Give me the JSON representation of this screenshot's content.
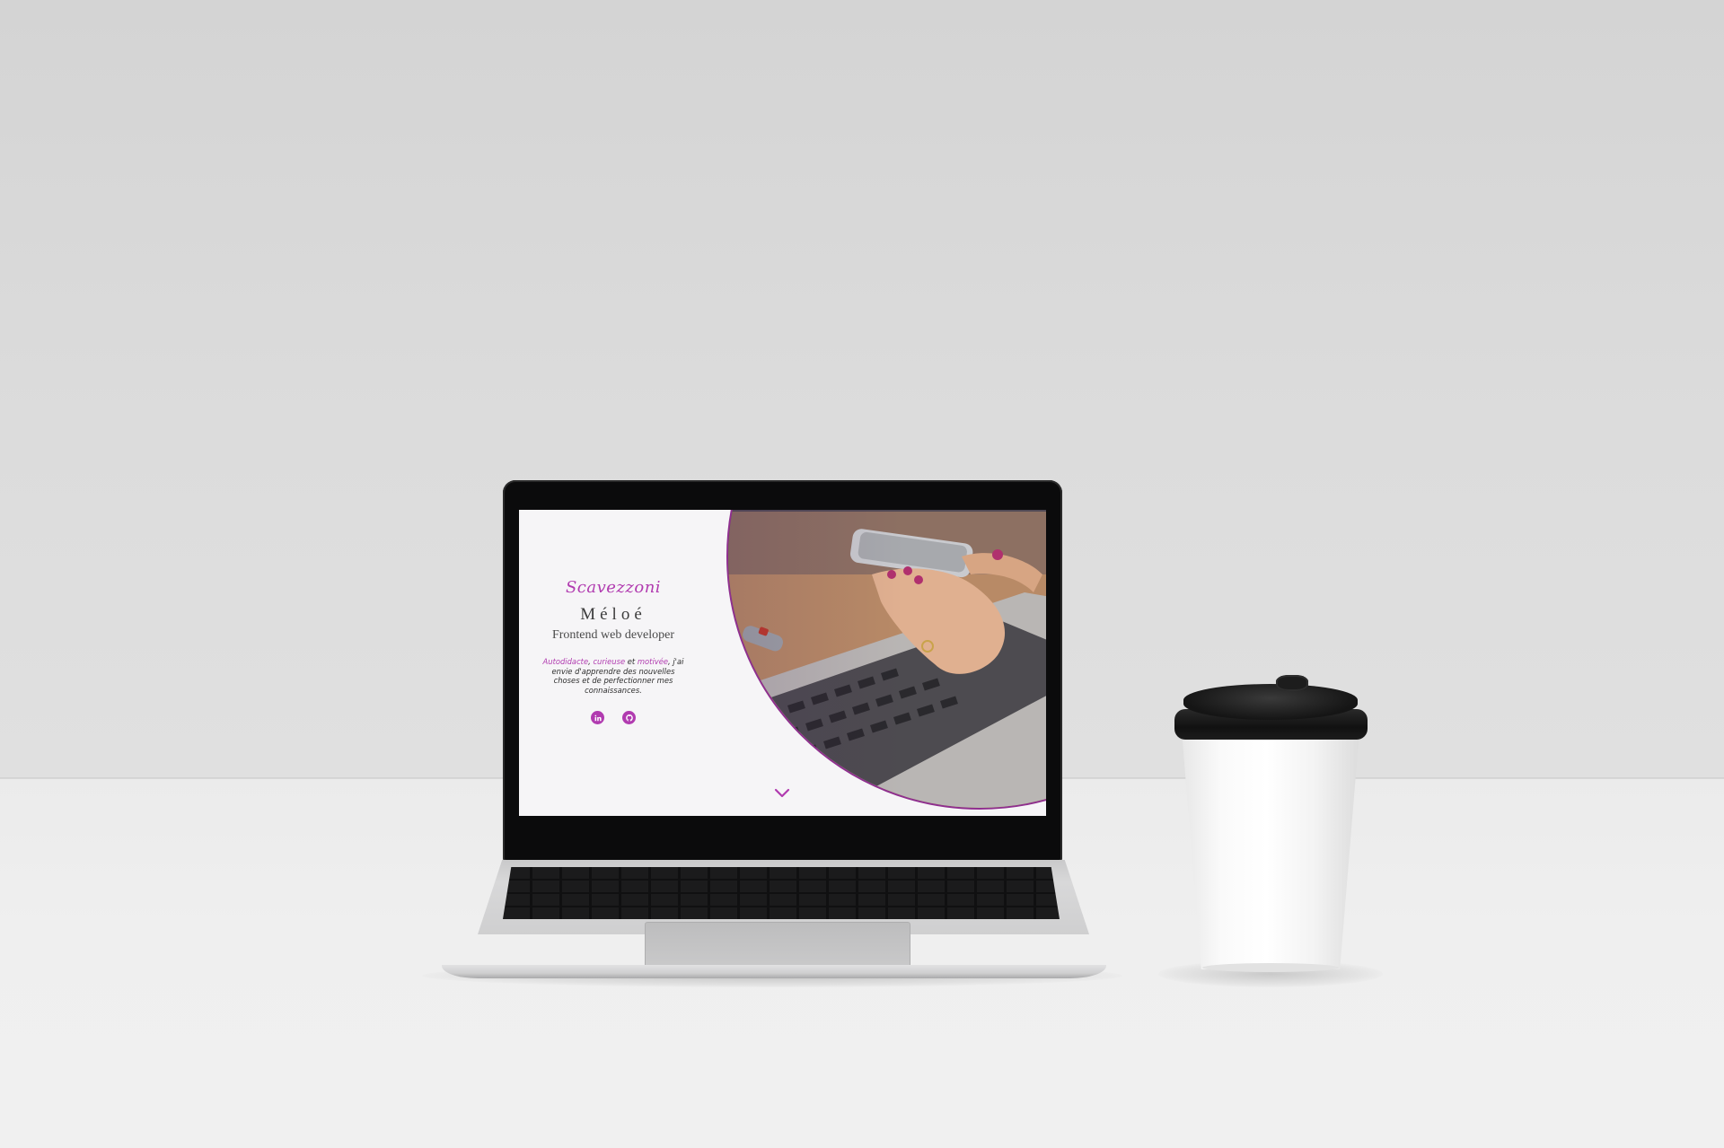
{
  "website": {
    "brand": "Scavezzoni",
    "name": "Méloé",
    "role": "Frontend web developer",
    "bio": {
      "word1": "Autodidacte",
      "sep1": ", ",
      "word2": "curieuse",
      "sep2": " et ",
      "word3": "motivée",
      "rest": ", j'ai envie d'apprendre des nouvelles choses et de perfectionner mes connaissances."
    },
    "socials": [
      {
        "icon": "linkedin-icon"
      },
      {
        "icon": "github-icon"
      }
    ],
    "scroll_icon": "chevron-down-icon",
    "colors": {
      "accent": "#b13bb0",
      "background": "#f6f5f7",
      "text": "#3c3c3c"
    }
  },
  "scene": {
    "objects": [
      "laptop",
      "coffee-cup"
    ],
    "colors": {
      "wall": "#d9d9d9",
      "desk": "#efefef",
      "laptop": "#cfcfd0",
      "cup_lid": "#151515",
      "cup": "#ffffff"
    }
  }
}
